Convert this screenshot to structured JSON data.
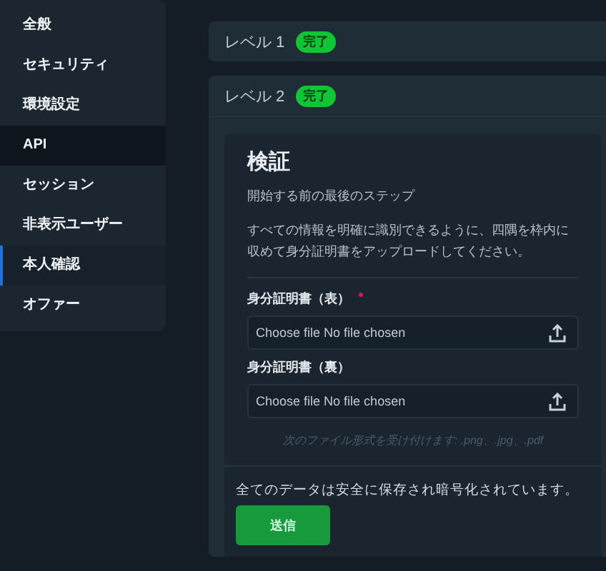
{
  "sidebar": {
    "items": [
      {
        "label": "全般",
        "selected": false,
        "highlighted": false
      },
      {
        "label": "セキュリティ",
        "selected": false,
        "highlighted": false
      },
      {
        "label": "環境設定",
        "selected": false,
        "highlighted": false
      },
      {
        "label": "API",
        "selected": false,
        "highlighted": true
      },
      {
        "label": "セッション",
        "selected": false,
        "highlighted": false
      },
      {
        "label": "非表示ユーザー",
        "selected": false,
        "highlighted": false
      },
      {
        "label": "本人確認",
        "selected": true,
        "highlighted": false
      },
      {
        "label": "オファー",
        "selected": false,
        "highlighted": false
      }
    ]
  },
  "levels": [
    {
      "title": "レベル 1",
      "badge": "完了",
      "expanded": false
    },
    {
      "title": "レベル 2",
      "badge": "完了",
      "expanded": true
    }
  ],
  "verification": {
    "title": "検証",
    "subtitle": "開始する前の最後のステップ",
    "description": "すべての情報を明確に識別できるように、四隅を枠内に収めて身分証明書をアップロードしてください。",
    "fields": [
      {
        "label": "身分証明書（表）",
        "required": true,
        "button": "Choose file",
        "value": "No file chosen"
      },
      {
        "label": "身分証明書（裏）",
        "required": false,
        "button": "Choose file",
        "value": "No file chosen"
      }
    ],
    "formats_note": "次のファイル形式を受け付けます: .png、.jpg、.pdf"
  },
  "footer": {
    "note": "全てのデータは安全に保存され暗号化されています。",
    "submit": "送信"
  }
}
